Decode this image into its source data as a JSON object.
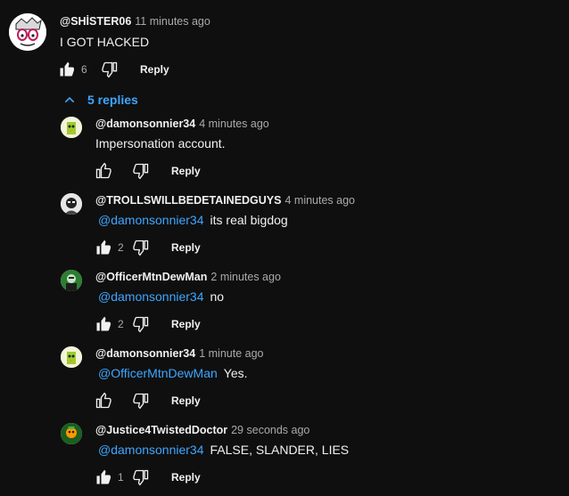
{
  "top_comment": {
    "author": "@SHİSTER06",
    "time": "11 minutes ago",
    "text": "I GOT HACKED",
    "likes": "6",
    "reply_label": "Reply",
    "avatar_icon": "cartoon-face-avatar"
  },
  "replies_toggle": {
    "label": "5 replies",
    "icon": "chevron-up-icon"
  },
  "replies": [
    {
      "author": "@damonsonnier34",
      "time": "4 minutes ago",
      "mention": "",
      "text": "Impersonation account.",
      "likes": "",
      "liked": false,
      "reply_label": "Reply",
      "avatar_color": "#f4f4d8"
    },
    {
      "author": "@TROLLSWILLBEDETAINEDGUYS",
      "time": "4 minutes ago",
      "mention": "@damonsonnier34",
      "text": "its real bigdog",
      "likes": "2",
      "liked": true,
      "reply_label": "Reply",
      "avatar_color": "#e6e6e6"
    },
    {
      "author": "@OfficerMtnDewMan",
      "time": "2 minutes ago",
      "mention": "@damonsonnier34",
      "text": "no",
      "likes": "2",
      "liked": true,
      "reply_label": "Reply",
      "avatar_color": "#2e7d32"
    },
    {
      "author": "@damonsonnier34",
      "time": "1 minute ago",
      "mention": "@OfficerMtnDewMan",
      "text": "Yes.",
      "likes": "",
      "liked": false,
      "reply_label": "Reply",
      "avatar_color": "#f4f4d8"
    },
    {
      "author": "@Justice4TwistedDoctor",
      "time": "29 seconds ago",
      "mention": "@damonsonnier34",
      "text": "FALSE, SLANDER, LIES",
      "likes": "1",
      "liked": true,
      "reply_label": "Reply",
      "avatar_color": "#1b5e20"
    }
  ],
  "colors": {
    "background": "#0f0f0f",
    "link": "#3ea6ff",
    "muted": "#aaaaaa",
    "text": "#f1f1f1"
  }
}
